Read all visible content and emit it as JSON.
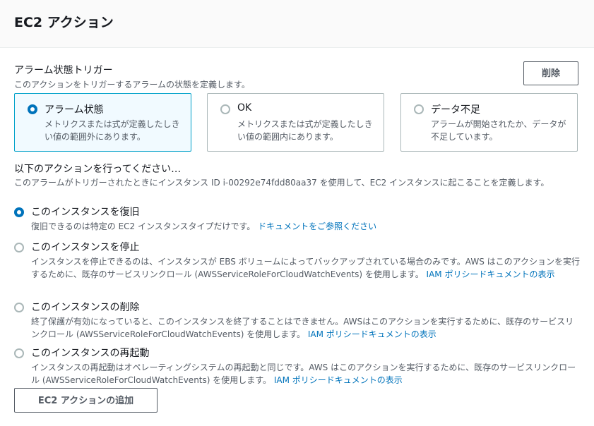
{
  "header": {
    "title": "EC2 アクション"
  },
  "trigger": {
    "label": "アラーム状態トリガー",
    "description": "このアクションをトリガーするアラームの状態を定義します。",
    "delete_label": "削除",
    "tiles": [
      {
        "title": "アラーム状態",
        "description": "メトリクスまたは式が定義したしきい値の範囲外にあります。",
        "selected": true
      },
      {
        "title": "OK",
        "description": "メトリクスまたは式が定義したしきい値の範囲内にあります。",
        "selected": false
      },
      {
        "title": "データ不足",
        "description": "アラームが開始されたか、データが不足しています。",
        "selected": false
      }
    ]
  },
  "actions": {
    "title": "以下のアクションを行ってください…",
    "description": "このアラームがトリガーされたときにインスタンス ID i-00292e74fdd80aa37 を使用して、EC2 インスタンスに起こることを定義します。",
    "options": [
      {
        "label": "このインスタンスを復旧",
        "description": "復旧できるのは特定の EC2 インスタンスタイプだけです。",
        "link": "ドキュメントをご参照ください",
        "selected": true
      },
      {
        "label": "このインスタンスを停止",
        "description": "インスタンスを停止できるのは、インスタンスが EBS ボリュームによってバックアップされている場合のみです。AWS はこのアクションを実行するために、既存のサービスリンクロール (AWSServiceRoleForCloudWatchEvents) を使用します。",
        "link": "IAM ポリシードキュメントの表示",
        "selected": false
      },
      {
        "label": "このインスタンスの削除",
        "description": "終了保護が有効になっていると、このインスタンスを終了することはできません。AWSはこのアクションを実行するために、既存のサービスリンクロール (AWSServiceRoleForCloudWatchEvents) を使用します。",
        "link": "IAM ポリシードキュメントの表示",
        "selected": false
      },
      {
        "label": "このインスタンスの再起動",
        "description": "インスタンスの再起動はオペレーティングシステムの再起動と同じです。AWS はこのアクションを実行するために、既存のサービスリンクロール (AWSServiceRoleForCloudWatchEvents) を使用します。",
        "link": "IAM ポリシードキュメントの表示",
        "selected": false
      }
    ],
    "add_label": "EC2 アクションの追加"
  },
  "colors": {
    "accent": "#0073bb",
    "selected_border": "#00a1c9",
    "selected_bg": "#f1faff",
    "muted_text": "#545b64"
  }
}
